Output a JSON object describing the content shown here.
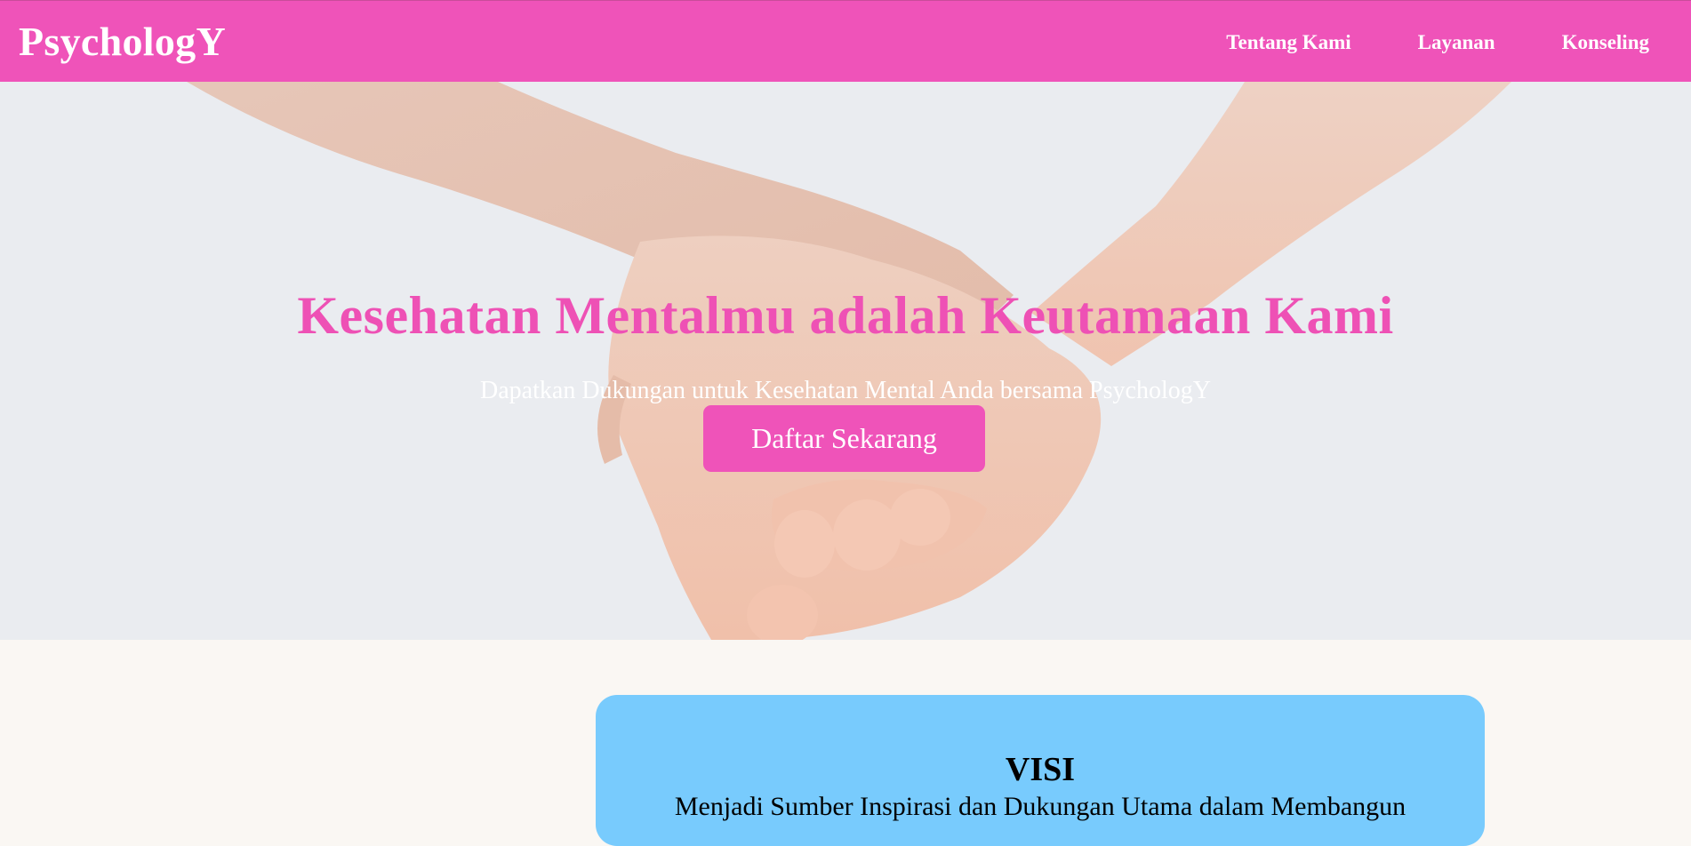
{
  "navbar": {
    "brand": "PsychologY",
    "links": [
      {
        "label": "Tentang Kami"
      },
      {
        "label": "Layanan"
      },
      {
        "label": "Konseling"
      }
    ]
  },
  "hero": {
    "title": "Kesehatan Mentalmu adalah Keutamaan Kami",
    "subtitle": "Dapatkan Dukungan untuk Kesehatan Mental Anda bersama PsychologY",
    "cta_label": "Daftar Sekarang"
  },
  "visi": {
    "title": "VISI",
    "text": "Menjadi Sumber Inspirasi dan Dukungan Utama dalam Membangun"
  },
  "colors": {
    "brand_pink": "#ef53b9",
    "title_pink": "#ee51b5",
    "card_blue": "#78cbfd",
    "page_background": "#faf7f3"
  }
}
